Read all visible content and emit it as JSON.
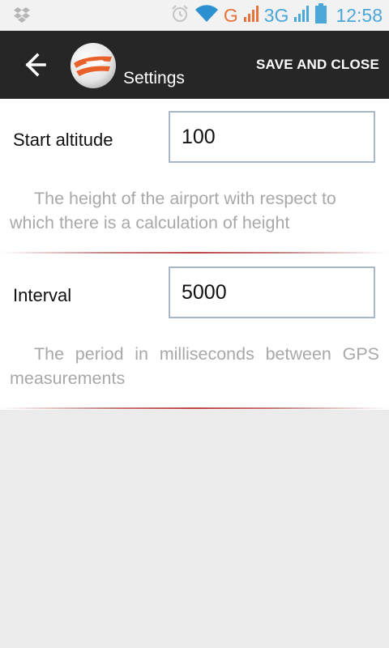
{
  "status_bar": {
    "time": "12:58",
    "network_label_g": "G",
    "network_label_3g": "3G",
    "icons": [
      "dropbox-icon",
      "alarm-icon",
      "wifi-icon",
      "signal-icon",
      "battery-icon"
    ]
  },
  "action_bar": {
    "title": "Settings",
    "save_label": "SAVE AND CLOSE"
  },
  "settings": [
    {
      "label": "Start altitude",
      "value": "100",
      "description": "The height of the airport with respect to which there is a calculation of height"
    },
    {
      "label": "Interval",
      "value": "5000",
      "description": "The period in milliseconds between GPS measurements"
    }
  ],
  "colors": {
    "action_bar_bg": "#262626",
    "accent_blue": "#4aa7d8",
    "accent_orange": "#e8733a",
    "divider_red": "#c04848"
  }
}
